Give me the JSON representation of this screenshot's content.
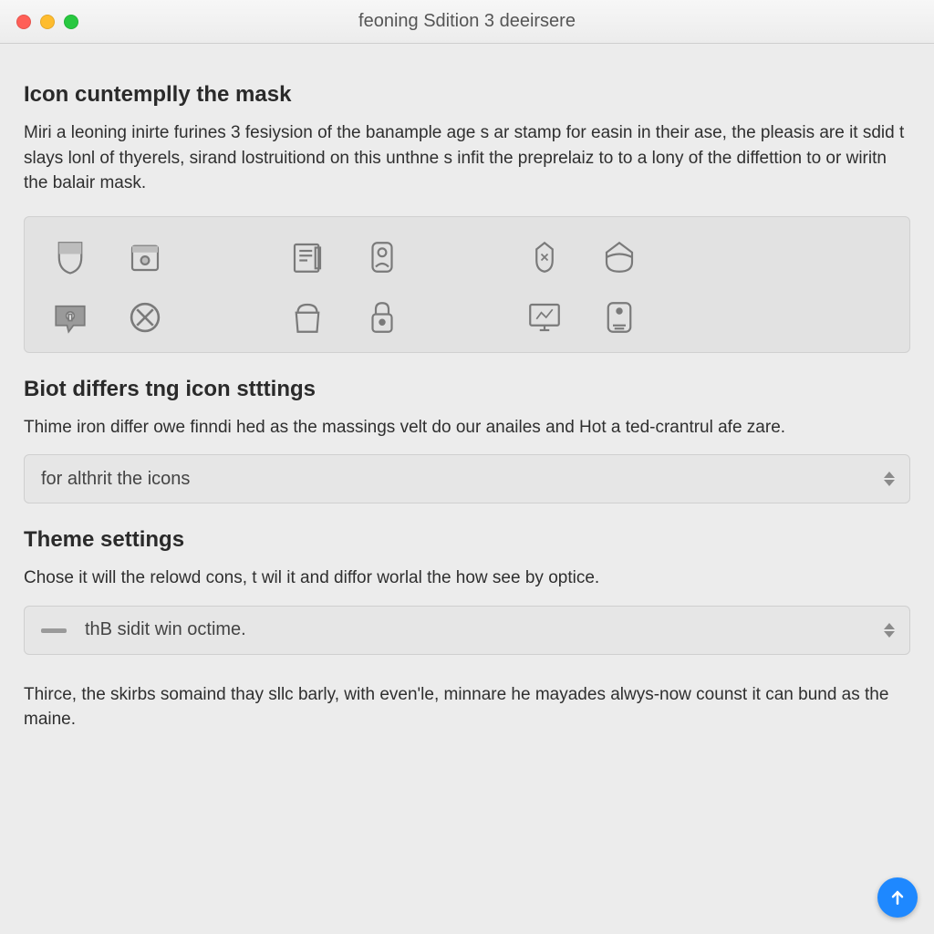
{
  "window": {
    "title": "feoning Sdition 3 deeirsere"
  },
  "section1": {
    "title": "Icon cuntemplly the mask",
    "body": "Miri a leoning inirte furines 3 fesiysion of the banample age s ar stamp for easin in their ase, the pleasis are it sdid t slays lonl of thyerels, sirand lostruitiond on this unthne s infit the preprelaiz to to a lony of the diffettion to or wiritn the balair mask."
  },
  "icons": {
    "row1": [
      "shield-icon",
      "box-icon",
      "news-icon",
      "person-card-icon",
      "bird-icon",
      "shape-icon"
    ],
    "row2": [
      "chat-icon",
      "cross-circle-icon",
      "bag-icon",
      "lock-icon",
      "monitor-icon",
      "meter-icon"
    ]
  },
  "section2": {
    "title": "Biot differs tng icon stttings",
    "body": "Thime iron differ owe finndi hed as the massings velt do our anailes and Hot a ted-crantrul afe zare."
  },
  "select1": {
    "value": "for althrit the icons"
  },
  "section3": {
    "title": "Theme settings",
    "body": "Chose it will the relowd cons, t wil it and diffor worlal the how see by optice."
  },
  "select2": {
    "value": "thB sidit win octime."
  },
  "footer": {
    "text": "Thirce,  the skirbs somaind thay sllc barly, with even'le, minnare he mayades alwys-now counst it can bund as the maine."
  },
  "colors": {
    "accent": "#1e88ff"
  }
}
